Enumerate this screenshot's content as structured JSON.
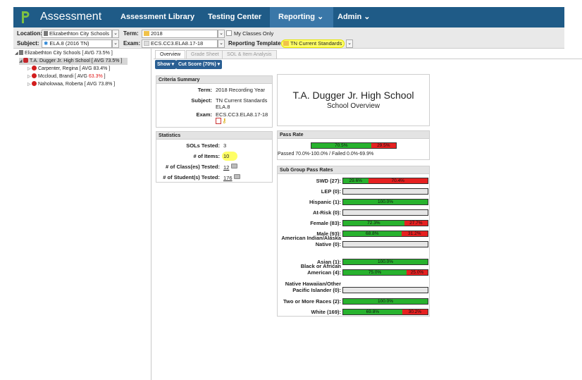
{
  "nav": {
    "title": "Assessment",
    "items": [
      {
        "label": "Assessment Library"
      },
      {
        "label": "Testing Center"
      },
      {
        "label": "Reporting ⌄"
      },
      {
        "label": "Admin ⌄"
      }
    ]
  },
  "filters": {
    "location_label": "Location:",
    "location_value": "Elizabethton City Schools",
    "term_label": "Term:",
    "term_value": "2018",
    "my_classes_label": "My Classes Only",
    "subject_label": "Subject:",
    "subject_value": "ELA.8 (2016 TN)",
    "exam_label": "Exam:",
    "exam_value": "ECS.CC3.ELA8.17-18",
    "template_label": "Reporting Template:",
    "template_value": "TN Current Standards"
  },
  "tree": [
    {
      "label": "Elizabethton City Schools [ AVG 73.5% ]"
    },
    {
      "label": "T.A. Dugger Jr. High School [ AVG 73.5% ]"
    },
    {
      "label": "Carpenter, Regina [ AVG 83.4% ]"
    },
    {
      "label_pre": "Mccloud, Brandi [ AVG ",
      "label_red": "63.3%",
      "label_post": " ]"
    },
    {
      "label": "Naholowaa, Roberta [ AVG 73.8% ]"
    }
  ],
  "tabs": [
    "Overview",
    "Grade Sheet",
    "SOL & Item Analysis"
  ],
  "buttons": {
    "show": "Show ▾",
    "cut_score": "Cut Score (70%) ▾"
  },
  "criteria": {
    "heading": "Criteria Summary",
    "term_label": "Term:",
    "term_value": "2018 Recording Year",
    "subject_label": "Subject:",
    "subject_value_1": "TN Current Standards",
    "subject_value_2": "ELA.8",
    "exam_label": "Exam:",
    "exam_value": "ECS.CC3.ELA8.17-18"
  },
  "school": {
    "name": "T.A. Dugger Jr. High School",
    "subtitle": "School Overview"
  },
  "statistics": {
    "heading": "Statistics",
    "sols_label": "SOLs Tested:",
    "sols_value": "3",
    "items_label": "# of Items:",
    "items_value": "10",
    "classes_label": "# of Class(es) Tested:",
    "classes_value": "12",
    "students_label": "# of Student(s) Tested:",
    "students_value": "176"
  },
  "pass_rate": {
    "heading": "Pass Rate",
    "pass_pct": 70.5,
    "pass_label": "70.5%",
    "fail_label": "29.5%",
    "note": "Passed 70.0%-100.0% / Failed 0.0%-69.9%"
  },
  "subgroups": {
    "heading": "Sub Group Pass Rates",
    "rows": [
      {
        "label": "SWD (27):",
        "pass": 29.6,
        "pass_label": "29.6%",
        "fail_label": "70.4%"
      },
      {
        "label": "LEP (0):",
        "pass": 0,
        "pass_label": "",
        "fail_label": ""
      },
      {
        "label": "Hispanic (1):",
        "pass": 100,
        "pass_label": "100.0%",
        "fail_label": ""
      },
      {
        "label": "At-Risk (0):",
        "pass": 0,
        "pass_label": "",
        "fail_label": ""
      },
      {
        "label": "Female (83):",
        "pass": 72.3,
        "pass_label": "72.3%",
        "fail_label": "27.7%"
      },
      {
        "label": "Male (93):",
        "pass": 68.8,
        "pass_label": "68.8%",
        "fail_label": "31.2%"
      },
      {
        "label": "American Indian/Alaska Native (0):",
        "pass": 0,
        "pass_label": "",
        "fail_label": ""
      },
      {
        "label": "Asian (1):",
        "pass": 100,
        "pass_label": "100.0%",
        "fail_label": ""
      },
      {
        "label": "Black or African American (4):",
        "pass": 75,
        "pass_label": "75.0%",
        "fail_label": "25.0%"
      },
      {
        "label": "Native Hawaiian/Other Pacific Islander (0):",
        "pass": 0,
        "pass_label": "",
        "fail_label": ""
      },
      {
        "label": "Two or More Races (2):",
        "pass": 100,
        "pass_label": "100.0%",
        "fail_label": ""
      },
      {
        "label": "White (169):",
        "pass": 69.8,
        "pass_label": "69.8%",
        "fail_label": "30.2%"
      }
    ]
  },
  "colors": {
    "nav": "#1f5b87",
    "pass": "#28b22e",
    "fail": "#e62020",
    "highlight": "#ffff66"
  }
}
